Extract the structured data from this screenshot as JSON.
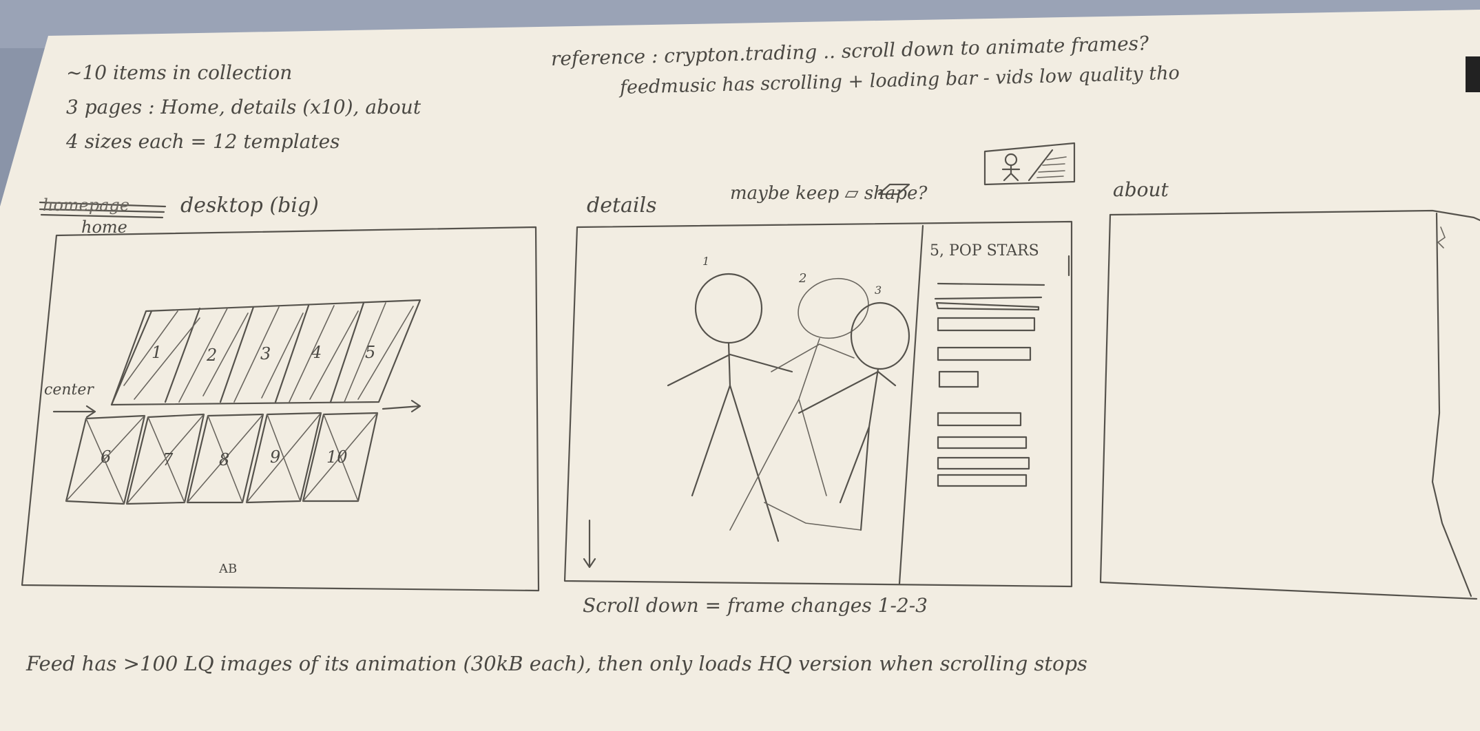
{
  "notes": {
    "line1": "~10 items in collection",
    "line2": "3 pages : Home, details (x10), about",
    "line3": "4 sizes each = 12 templates",
    "ref1": "reference : crypton.trading .. scroll down to animate frames?",
    "ref2": "feedmusic has scrolling + loading bar - vids low quality tho",
    "bottom": "Feed has >100 LQ images of its animation (30kB each), then only loads HQ version when scrolling stops"
  },
  "home": {
    "crossed_label": "homepage",
    "label": "desktop (big)",
    "sublabel": "home",
    "center_label": "center",
    "footer": "AB",
    "top_row": [
      "1",
      "2",
      "3",
      "4",
      "5"
    ],
    "bottom_row": [
      "6",
      "7",
      "8",
      "9",
      "10"
    ]
  },
  "details": {
    "label": "details",
    "note": "maybe keep ▱ shape?",
    "sidebar_title": "5, POP STARS",
    "figures": [
      "1",
      "2",
      "3"
    ],
    "caption": "Scroll down = frame changes 1-2-3"
  },
  "about": {
    "label": "about"
  },
  "colors": {
    "paper": "#f2ede2",
    "pencil": "#4a4843",
    "background": "#8a94a8"
  }
}
